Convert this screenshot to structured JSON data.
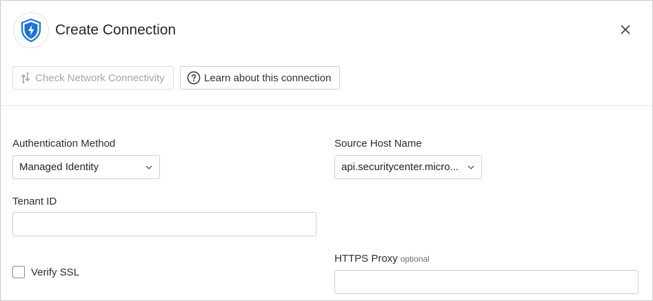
{
  "dialog": {
    "title": "Create Connection",
    "logo_icon": "shield-lightning-icon",
    "close_icon": "close-icon"
  },
  "toolbar": {
    "check_label": "Check Network Connectivity",
    "check_icon": "network-connectivity-icon",
    "learn_label": "Learn about this connection",
    "learn_icon": "help-circle-icon"
  },
  "form": {
    "auth_method": {
      "label": "Authentication Method",
      "value": "Managed Identity"
    },
    "source_host": {
      "label": "Source Host Name",
      "value": "api.securitycenter.micro..."
    },
    "tenant_id": {
      "label": "Tenant ID",
      "value": ""
    },
    "verify_ssl": {
      "label": "Verify SSL",
      "checked": false
    },
    "https_proxy": {
      "label": "HTTPS Proxy",
      "optional": "optional",
      "value": ""
    }
  },
  "colors": {
    "brand_blue": "#1a73d9",
    "border": "#cfcfcf",
    "disabled_text": "#a6a6a6"
  }
}
